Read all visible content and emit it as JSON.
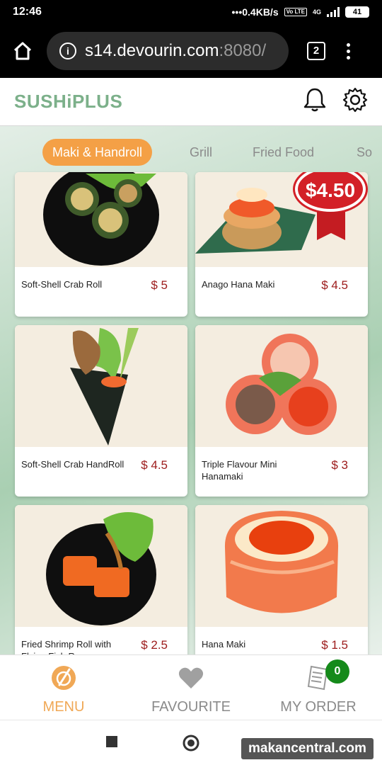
{
  "status_bar": {
    "time": "12:46",
    "speed": "0.4KB/s",
    "network": "4G",
    "volte": "Vo LTE",
    "battery": "41"
  },
  "browser": {
    "url_host": "s14.devourin.com",
    "url_port": ":8080/",
    "tab_count": "2"
  },
  "app": {
    "logo": "SUSHiPLUS"
  },
  "categories": [
    {
      "label": "Maki & Handroll",
      "active": true
    },
    {
      "label": "Grill",
      "active": false
    },
    {
      "label": "Fried Food",
      "active": false
    },
    {
      "label": "So",
      "active": false
    }
  ],
  "products": [
    {
      "name": "Soft-Shell Crab Roll",
      "price": "$ 5"
    },
    {
      "name": "Anago Hana Maki",
      "price": "$ 4.5",
      "promo_badge": "$4.50"
    },
    {
      "name": "Soft-Shell Crab HandRoll",
      "price": "$ 4.5"
    },
    {
      "name": "Triple Flavour Mini Hanamaki",
      "price": "$ 3"
    },
    {
      "name": "Fried Shrimp Roll with Flying Fish Roe",
      "price": "$ 2.5"
    },
    {
      "name": "Hana Maki",
      "price": "$ 1.5"
    }
  ],
  "bottom_nav": {
    "menu": "MENU",
    "favourite": "FAVOURITE",
    "my_order": "MY ORDER",
    "order_count": "0"
  },
  "watermark": "makancentral.com",
  "colors": {
    "brand_green": "#7cb08a",
    "accent_orange": "#f4a046",
    "price_red": "#9c1a1a",
    "badge_green": "#158a1a"
  }
}
